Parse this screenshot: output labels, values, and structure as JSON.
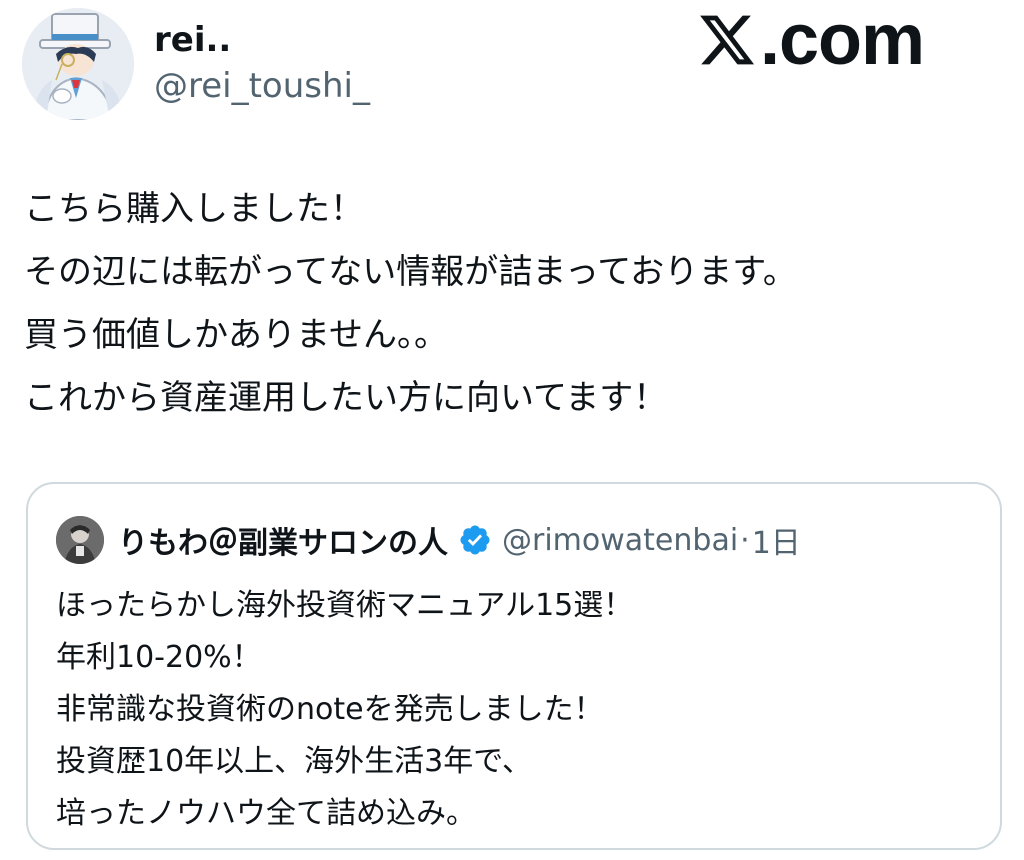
{
  "author": {
    "display_name": "rei..",
    "handle": "@rei_toushi_",
    "avatar_icon": "anime-character-avatar-icon"
  },
  "brand": {
    "logo_text": ".com",
    "logo_icon": "x-logo-icon"
  },
  "tweet": {
    "lines": [
      "こちら購入しました！",
      "その辺には転がってない情報が詰まっております。",
      "買う価値しかありません。。",
      "これから資産運用したい方に向いてます！"
    ]
  },
  "quoted_tweet": {
    "display_name": "りもわ＠副業サロンの人",
    "verified_icon": "verified-badge-icon",
    "handle": "@rimowatenbai",
    "separator": "·",
    "time": "1日",
    "lines": [
      "ほったらかし海外投資術マニュアル15選！",
      "年利10-20%！",
      "非常識な投資術のnoteを発売しました！",
      "投資歴10年以上、海外生活3年で、",
      "培ったノウハウ全て詰め込み。"
    ]
  },
  "colors": {
    "text_primary": "#0f1419",
    "text_secondary": "#536471",
    "border": "#cfd9de",
    "verified_blue": "#1d9bf0"
  }
}
